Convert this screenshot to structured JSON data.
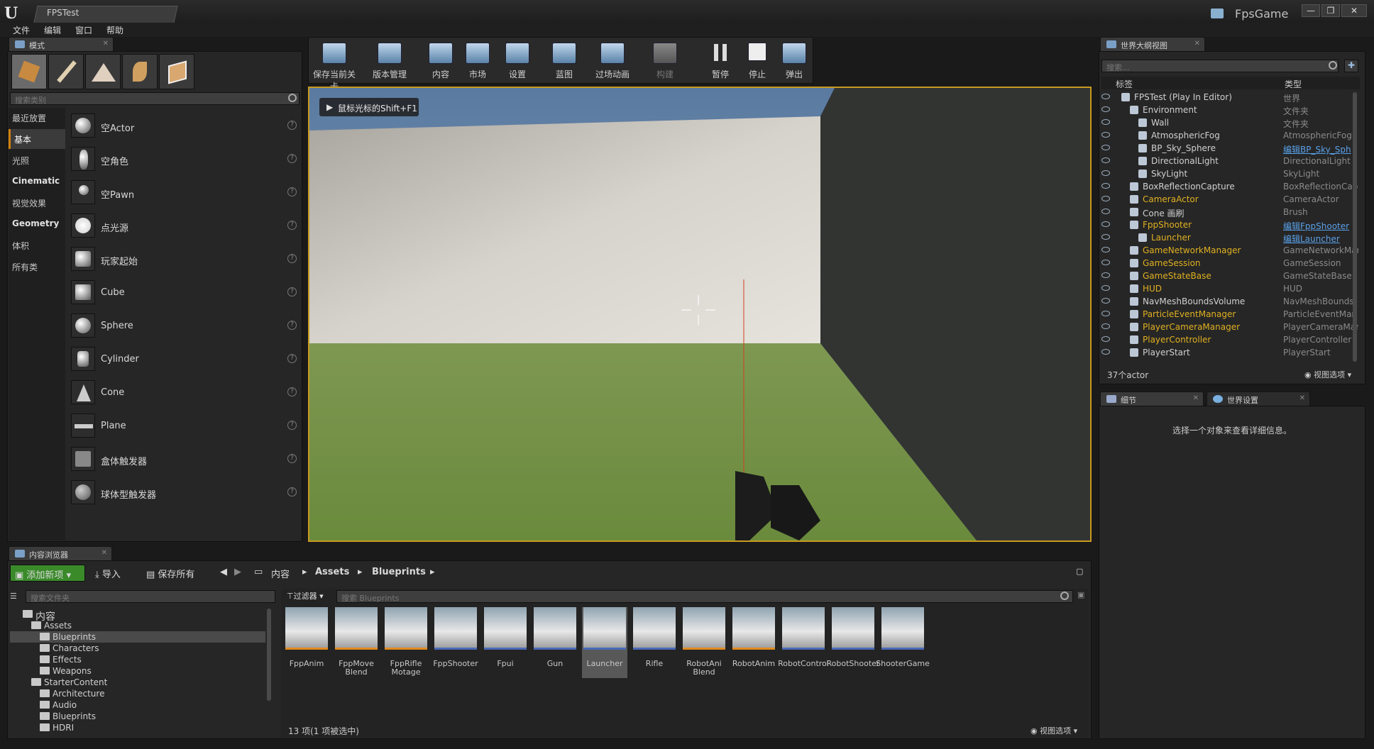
{
  "window": {
    "doc_tab": "FPSTest",
    "project_name": "FpsGame",
    "minimize": "—",
    "maximize": "❐",
    "close": "✕"
  },
  "menu": [
    "文件",
    "编辑",
    "窗口",
    "帮助"
  ],
  "modes_panel": {
    "tab_label": "模式",
    "search_placeholder": "搜索类别",
    "categories": [
      "最近放置",
      "基本",
      "光照",
      "Cinematic",
      "视觉效果",
      "Geometry",
      "体积",
      "所有类"
    ],
    "active_category": "基本",
    "items": [
      "空Actor",
      "空角色",
      "空Pawn",
      "点光源",
      "玩家起始",
      "Cube",
      "Sphere",
      "Cylinder",
      "Cone",
      "Plane",
      "盒体触发器",
      "球体型触发器"
    ]
  },
  "toolbar": {
    "buttons": [
      "保存当前关卡",
      "版本管理",
      "内容",
      "市场",
      "设置",
      "蓝图",
      "过场动画",
      "构建",
      "暂停",
      "停止",
      "弹出"
    ]
  },
  "viewport": {
    "hint": "鼠标光标的Shift+F1"
  },
  "outliner": {
    "tab_label": "世界大纲视图",
    "search_placeholder": "搜索...",
    "col_label": "标签",
    "col_type": "类型",
    "rows": [
      {
        "name": "FPSTest (Play In Editor)",
        "type": "世界",
        "indent": 0,
        "link_name": false,
        "link_type": false
      },
      {
        "name": "Environment",
        "type": "文件夹",
        "indent": 1,
        "link_name": false,
        "link_type": false
      },
      {
        "name": "Wall",
        "type": "文件夹",
        "indent": 2,
        "link_name": false,
        "link_type": false
      },
      {
        "name": "AtmosphericFog",
        "type": "AtmosphericFog",
        "indent": 2,
        "link_name": false,
        "link_type": false
      },
      {
        "name": "BP_Sky_Sphere",
        "type": "编辑BP_Sky_Sph",
        "indent": 2,
        "link_name": false,
        "link_type": true
      },
      {
        "name": "DirectionalLight",
        "type": "DirectionalLight",
        "indent": 2,
        "link_name": false,
        "link_type": false
      },
      {
        "name": "SkyLight",
        "type": "SkyLight",
        "indent": 2,
        "link_name": false,
        "link_type": false
      },
      {
        "name": "BoxReflectionCapture",
        "type": "BoxReflectionCap",
        "indent": 1,
        "link_name": false,
        "link_type": false
      },
      {
        "name": "CameraActor",
        "type": "CameraActor",
        "indent": 1,
        "link_name": true,
        "link_type": false
      },
      {
        "name": "Cone 画刷",
        "type": "Brush",
        "indent": 1,
        "link_name": false,
        "link_type": false
      },
      {
        "name": "FppShooter",
        "type": "编辑FppShooter",
        "indent": 1,
        "link_name": true,
        "link_type": true
      },
      {
        "name": "Launcher",
        "type": "编辑Launcher",
        "indent": 2,
        "link_name": true,
        "link_type": true
      },
      {
        "name": "GameNetworkManager",
        "type": "GameNetworkMar",
        "indent": 1,
        "link_name": true,
        "link_type": false
      },
      {
        "name": "GameSession",
        "type": "GameSession",
        "indent": 1,
        "link_name": true,
        "link_type": false
      },
      {
        "name": "GameStateBase",
        "type": "GameStateBase",
        "indent": 1,
        "link_name": true,
        "link_type": false
      },
      {
        "name": "HUD",
        "type": "HUD",
        "indent": 1,
        "link_name": true,
        "link_type": false
      },
      {
        "name": "NavMeshBoundsVolume",
        "type": "NavMeshBounds\\",
        "indent": 1,
        "link_name": false,
        "link_type": false
      },
      {
        "name": "ParticleEventManager",
        "type": "ParticleEventMan",
        "indent": 1,
        "link_name": true,
        "link_type": false
      },
      {
        "name": "PlayerCameraManager",
        "type": "PlayerCameraMar",
        "indent": 1,
        "link_name": true,
        "link_type": false
      },
      {
        "name": "PlayerController",
        "type": "PlayerController",
        "indent": 1,
        "link_name": true,
        "link_type": false
      },
      {
        "name": "PlayerStart",
        "type": "PlayerStart",
        "indent": 1,
        "link_name": false,
        "link_type": false
      }
    ],
    "actor_count": "37个actor",
    "view_options": "视图选项"
  },
  "details": {
    "tab_label": "细节",
    "tab2_label": "世界设置",
    "empty_msg": "选择一个对象来查看详细信息。"
  },
  "content_browser": {
    "tab_label": "内容浏览器",
    "add_new": "添加新项",
    "import": "导入",
    "save_all": "保存所有",
    "path": [
      "内容",
      "Assets",
      "Blueprints"
    ],
    "folder_search_placeholder": "搜索文件夹",
    "filters": "过滤器",
    "asset_search_placeholder": "搜索 Blueprints",
    "tree": [
      {
        "label": "内容",
        "indent": 0
      },
      {
        "label": "Assets",
        "indent": 1
      },
      {
        "label": "Blueprints",
        "indent": 2
      },
      {
        "label": "Characters",
        "indent": 2
      },
      {
        "label": "Effects",
        "indent": 2
      },
      {
        "label": "Weapons",
        "indent": 2
      },
      {
        "label": "StarterContent",
        "indent": 1
      },
      {
        "label": "Architecture",
        "indent": 2
      },
      {
        "label": "Audio",
        "indent": 2
      },
      {
        "label": "Blueprints",
        "indent": 2
      },
      {
        "label": "HDRI",
        "indent": 2
      }
    ],
    "assets": [
      {
        "name": "FppAnim",
        "color": "#e08a20"
      },
      {
        "name": "FppMove\nBlend",
        "color": "#e08a20"
      },
      {
        "name": "FppRifle\nMotage",
        "color": "#e08a20"
      },
      {
        "name": "FppShooter",
        "color": "#4a6ab8"
      },
      {
        "name": "Fpui",
        "color": "#4a6ab8"
      },
      {
        "name": "Gun",
        "color": "#4a6ab8"
      },
      {
        "name": "Launcher",
        "color": "#4a6ab8"
      },
      {
        "name": "Rifle",
        "color": "#4a6ab8"
      },
      {
        "name": "RobotAni\nBlend",
        "color": "#e08a20"
      },
      {
        "name": "RobotAnim",
        "color": "#e08a20"
      },
      {
        "name": "RobotControl",
        "color": "#4a6ab8"
      },
      {
        "name": "RobotShooter",
        "color": "#4a6ab8"
      },
      {
        "name": "ShooterGame",
        "color": "#4a6ab8"
      }
    ],
    "selected_asset": "Launcher",
    "status": "13 项(1 项被选中)",
    "view_options": "视图选项"
  }
}
